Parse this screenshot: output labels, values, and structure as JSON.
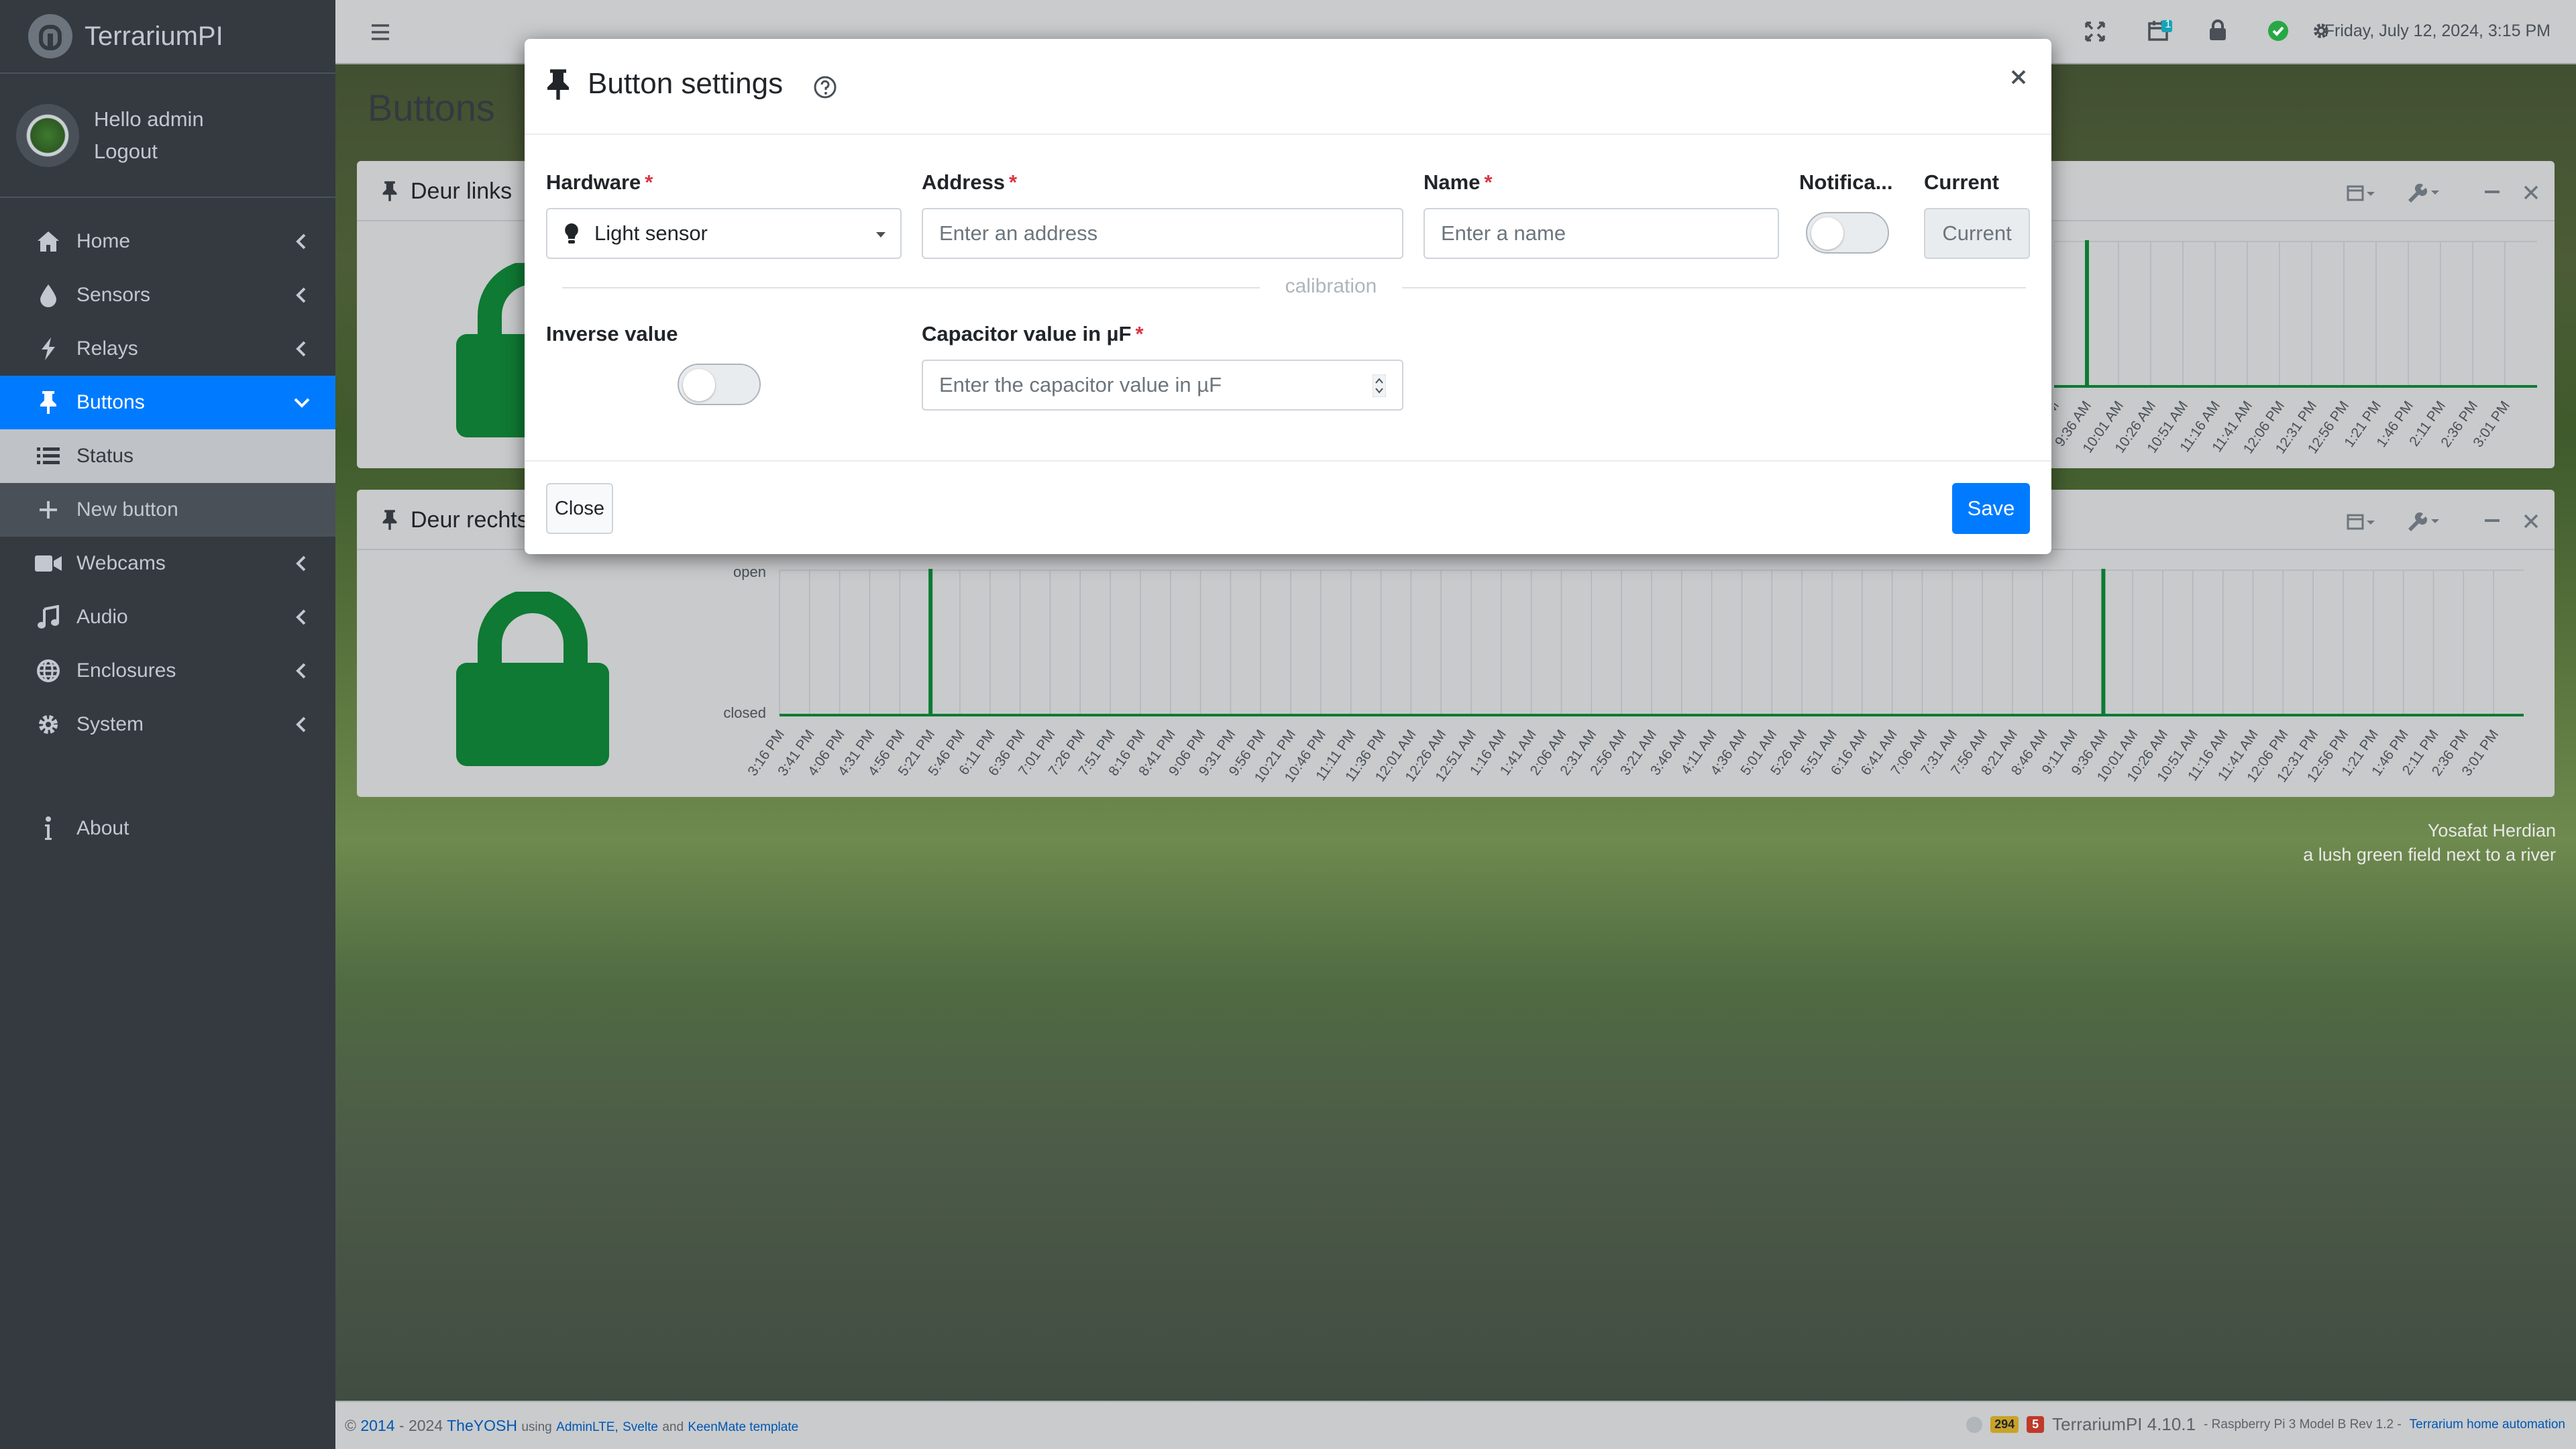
{
  "app": {
    "name": "TerrariumPI"
  },
  "user": {
    "greeting": "Hello admin",
    "logout": "Logout"
  },
  "sidebar": {
    "items": [
      {
        "label": "Home"
      },
      {
        "label": "Sensors"
      },
      {
        "label": "Relays"
      },
      {
        "label": "Buttons"
      },
      {
        "label": "Status"
      },
      {
        "label": "New button"
      },
      {
        "label": "Webcams"
      },
      {
        "label": "Audio"
      },
      {
        "label": "Enclosures"
      },
      {
        "label": "System"
      },
      {
        "label": "About"
      }
    ]
  },
  "topbar": {
    "date": "Friday, July 12, 2024, 3:15 PM",
    "calendar_badge": "1"
  },
  "page": {
    "title": "Buttons"
  },
  "cards": [
    {
      "title": "Deur links"
    },
    {
      "title": "Deur rechts",
      "y_labels": [
        "open",
        "closed"
      ]
    }
  ],
  "chart_data": {
    "type": "line",
    "title": "Deur rechts",
    "categories": [
      "3:16 PM",
      "3:41 PM",
      "4:06 PM",
      "4:31 PM",
      "4:56 PM",
      "5:21 PM",
      "5:46 PM",
      "6:11 PM",
      "6:36 PM",
      "7:01 PM",
      "7:26 PM",
      "7:51 PM",
      "8:16 PM",
      "8:41 PM",
      "9:06 PM",
      "9:31 PM",
      "9:56 PM",
      "10:21 PM",
      "10:46 PM",
      "11:11 PM",
      "11:36 PM",
      "12:01 AM",
      "12:26 AM",
      "12:51 AM",
      "1:16 AM",
      "1:41 AM",
      "2:06 AM",
      "2:31 AM",
      "2:56 AM",
      "3:21 AM",
      "3:46 AM",
      "4:11 AM",
      "4:36 AM",
      "5:01 AM",
      "5:26 AM",
      "5:51 AM",
      "6:16 AM",
      "6:41 AM",
      "7:06 AM",
      "7:31 AM",
      "7:56 AM",
      "8:21 AM",
      "8:46 AM",
      "9:11 AM",
      "9:36 AM",
      "10:01 AM",
      "10:26 AM",
      "10:51 AM",
      "11:16 AM",
      "11:41 AM",
      "12:06 PM",
      "12:31 PM",
      "12:56 PM",
      "1:21 PM",
      "1:46 PM",
      "2:11 PM",
      "2:36 PM",
      "3:01 PM"
    ],
    "y_categories": [
      "closed",
      "open"
    ],
    "events_open_at": [
      "5:21 PM",
      "9:36 AM"
    ]
  },
  "modal": {
    "title": "Button settings",
    "fields": {
      "hardware": {
        "label": "Hardware",
        "value": "Light sensor"
      },
      "address": {
        "label": "Address",
        "placeholder": "Enter an address"
      },
      "name": {
        "label": "Name",
        "placeholder": "Enter a name"
      },
      "notification": {
        "label": "Notifica..."
      },
      "current": {
        "label": "Current",
        "value": "Current"
      },
      "inverse": {
        "label": "Inverse value"
      },
      "capacitor": {
        "label": "Capacitor value in µF",
        "placeholder": "Enter the capacitor value in µF"
      }
    },
    "section": "calibration",
    "close_label": "Close",
    "save_label": "Save"
  },
  "photo_credit": {
    "author": "Yosafat Herdian",
    "description": "a lush green field next to a river"
  },
  "footer": {
    "copyright_start": "©",
    "year_link": "2014",
    "year_end": "- 2024",
    "author": "TheYOSH",
    "using": "using",
    "adminlte": "AdminLTE,",
    "svelte": "Svelte",
    "and": "and",
    "keenmate": "KeenMate template",
    "badge_count": "294",
    "badge_red": "5",
    "version": "TerrariumPI 4.10.1",
    "device": "- Raspberry Pi 3 Model B Rev 1.2 -",
    "home_link": "Terrarium home automation"
  },
  "colors": {
    "primary": "#007bff",
    "sidebar": "#343a40",
    "lock_green": "#0e7a33",
    "required": "#dc3545"
  }
}
